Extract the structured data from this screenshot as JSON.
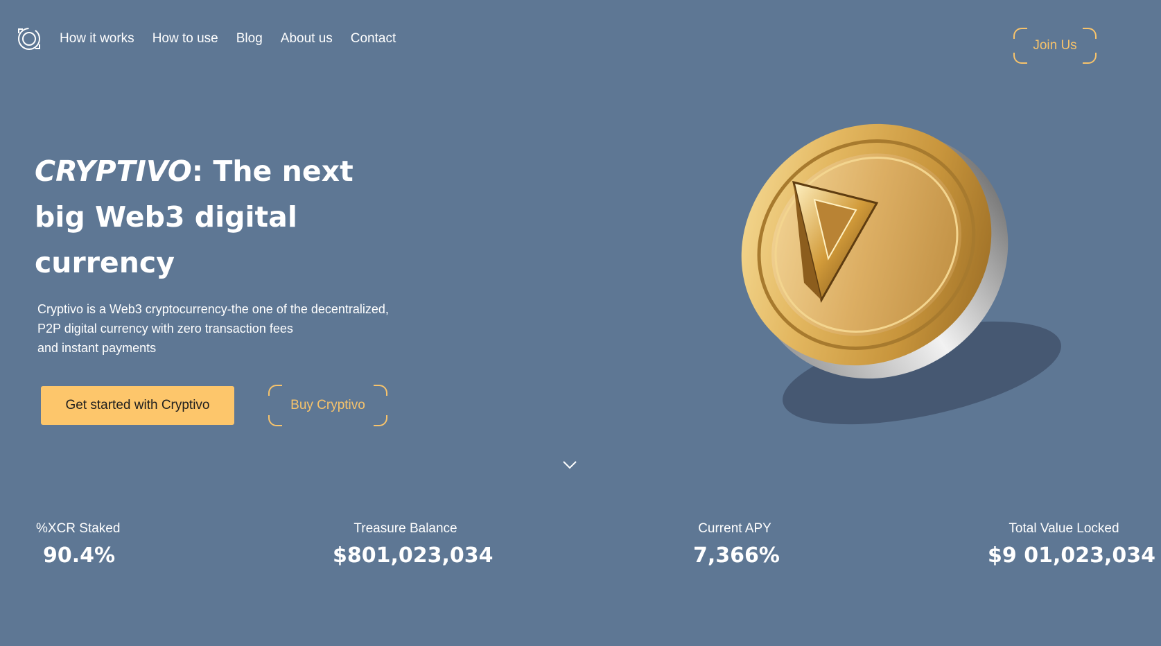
{
  "nav": {
    "logo_icon": "cryptivo-logo-icon",
    "links": [
      "How it works",
      "How to use",
      "Blog",
      "About us",
      "Contact"
    ],
    "join_label": "Join Us"
  },
  "hero": {
    "title_brand": "CRYPTIVO",
    "title_rest": ": The next big Web3 digital currency",
    "description_lines": [
      "Cryptivo is a Web3 cryptocurrency-the one of the decentralized,",
      "P2P digital currency with zero transaction fees",
      "and instant payments"
    ],
    "primary_button": "Get started with Cryptivo",
    "secondary_button": "Buy Cryptivo",
    "scroll_icon": "chevron-down-icon",
    "coin_image": "gold-coin-illustration"
  },
  "stats": [
    {
      "label": "%XCR Staked",
      "value": "90.4%"
    },
    {
      "label": "Treasure Balance",
      "value": "$801,023,034"
    },
    {
      "label": "Current APY",
      "value": "7,366%"
    },
    {
      "label": "Total Value Locked",
      "value": "$9 01,023,034"
    }
  ],
  "colors": {
    "background": "#5e7794",
    "accent": "#fdc66b",
    "accent_text": "#f7c36b",
    "text": "#ffffff"
  }
}
